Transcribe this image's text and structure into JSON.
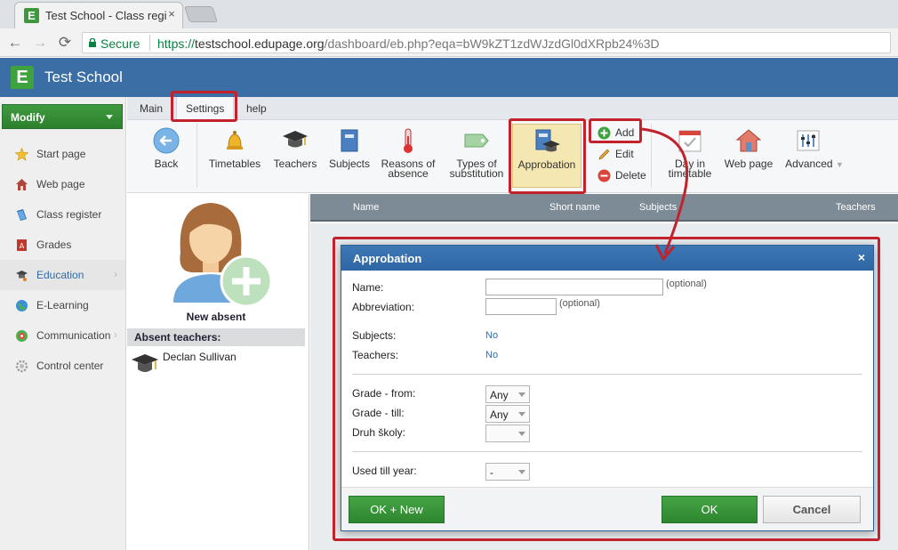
{
  "browser": {
    "tab_title": "Test School - Class regist",
    "tab_close": "×",
    "secure_label": "Secure",
    "url_scheme": "https://",
    "url_host": "testschool.edupage.org",
    "url_rest": "/dashboard/eb.php?eqa=bW9kZT1zdWJzdGl0dXRpb24%3D",
    "back_glyph": "←",
    "forward_glyph": "→",
    "reload_glyph": "⟳"
  },
  "app": {
    "logo_letter": "E",
    "school_name": "Test School",
    "brand_color": "#3a6ea5"
  },
  "sidebar": {
    "modify_label": "Modify",
    "items": [
      {
        "label": "Start page",
        "icon": "star-icon"
      },
      {
        "label": "Web page",
        "icon": "house-icon"
      },
      {
        "label": "Class register",
        "icon": "book-icon"
      },
      {
        "label": "Grades",
        "icon": "grades-icon"
      },
      {
        "label": "Education",
        "icon": "education-icon",
        "chevron": "›"
      },
      {
        "label": "E-Learning",
        "icon": "globe-icon"
      },
      {
        "label": "Communication",
        "icon": "communication-icon",
        "chevron": "›"
      },
      {
        "label": "Control center",
        "icon": "gear-icon"
      }
    ]
  },
  "menu": {
    "tabs": [
      {
        "label": "Main"
      },
      {
        "label": "Settings",
        "active": true
      },
      {
        "label": "help"
      }
    ]
  },
  "ribbon": {
    "back": "Back",
    "timetables": "Timetables",
    "teachers": "Teachers",
    "subjects": "Subjects",
    "reasons_1": "Reasons of",
    "reasons_2": "absence",
    "types_1": "Types of",
    "types_2": "substitution",
    "approbation": "Approbation",
    "add": "Add",
    "edit": "Edit",
    "delete": "Delete",
    "day_1": "Day in",
    "day_2": "timetable",
    "web_page": "Web page",
    "advanced": "Advanced",
    "advanced_caret": "▼"
  },
  "absent": {
    "new_absent": "New absent",
    "header": "Absent teachers:",
    "teachers": [
      "Declan Sullivan"
    ]
  },
  "grid": {
    "columns": [
      "Name",
      "Short name",
      "Subjects",
      "Teachers"
    ]
  },
  "dialog": {
    "title": "Approbation",
    "close": "×",
    "name_label": "Name:",
    "name_value": "",
    "optional": "(optional)",
    "abbr_label": "Abbreviation:",
    "abbr_value": "",
    "subjects_label": "Subjects:",
    "subjects_value": "No",
    "teachers_label": "Teachers:",
    "teachers_value": "No",
    "grade_from_label": "Grade - from:",
    "grade_from_value": "Any",
    "grade_till_label": "Grade - till:",
    "grade_till_value": "Any",
    "druh_label": "Druh školy:",
    "druh_value": "",
    "used_label": "Used till year:",
    "used_value": "-",
    "ok_new": "OK + New",
    "ok": "OK",
    "cancel": "Cancel"
  },
  "annotation_color": "#c1222b"
}
